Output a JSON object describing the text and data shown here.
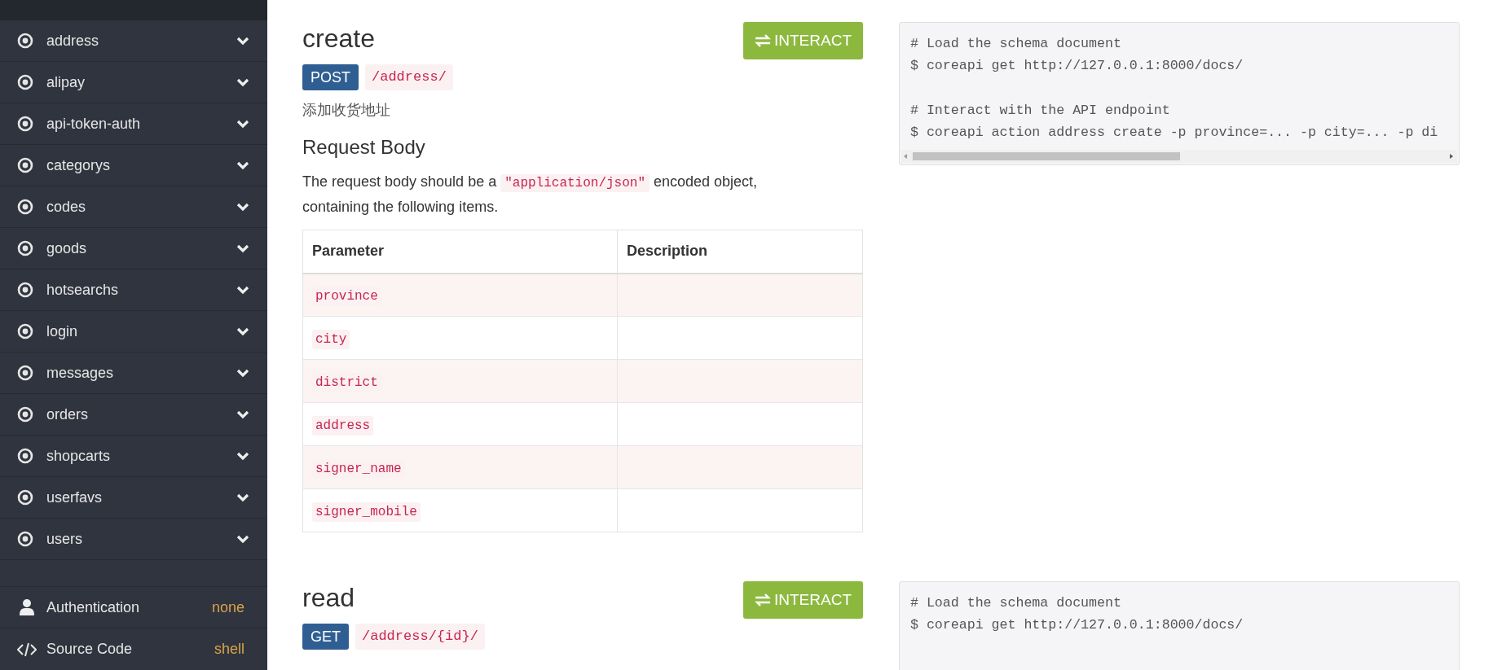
{
  "sidebar": {
    "items": [
      {
        "label": "address"
      },
      {
        "label": "alipay"
      },
      {
        "label": "api-token-auth"
      },
      {
        "label": "categorys"
      },
      {
        "label": "codes"
      },
      {
        "label": "goods"
      },
      {
        "label": "hotsearchs"
      },
      {
        "label": "login"
      },
      {
        "label": "messages"
      },
      {
        "label": "orders"
      },
      {
        "label": "shopcarts"
      },
      {
        "label": "userfavs"
      },
      {
        "label": "users"
      }
    ],
    "footer": [
      {
        "kind": "user",
        "label": "Authentication",
        "value": "none"
      },
      {
        "kind": "code",
        "label": "Source Code",
        "value": "shell"
      }
    ]
  },
  "endpoints": [
    {
      "title": "create",
      "method": "POST",
      "path": "/address/",
      "description": "添加收货地址",
      "button": "INTERACT",
      "request_body": {
        "heading": "Request Body",
        "text_before": "The request body should be a",
        "media_type": "\"application/json\"",
        "text_after": "encoded object, containing the following items.",
        "columns": [
          "Parameter",
          "Description"
        ],
        "parameters": [
          "province",
          "city",
          "district",
          "address",
          "signer_name",
          "signer_mobile"
        ]
      },
      "code": [
        [
          "# Load the schema document",
          "$ coreapi get http://127.0.0.1:8000/docs/"
        ],
        [
          "# Interact with the API endpoint",
          "$ coreapi action address create -p province=... -p city=... -p di"
        ]
      ]
    },
    {
      "title": "read",
      "method": "GET",
      "path": "/address/{id}/",
      "button": "INTERACT",
      "code": [
        [
          "# Load the schema document",
          "$ coreapi get http://127.0.0.1:8000/docs/"
        ]
      ]
    }
  ]
}
